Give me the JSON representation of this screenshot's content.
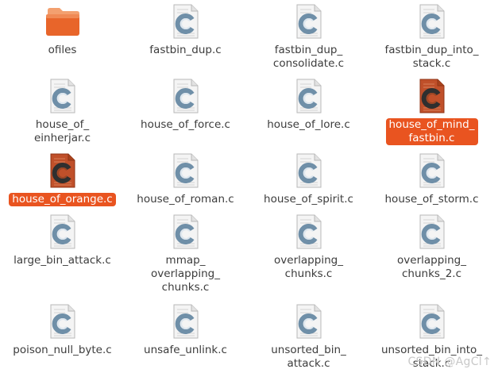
{
  "files": [
    {
      "name": "ofiles",
      "kind": "folder",
      "selected": false
    },
    {
      "name": "fastbin_dup.c",
      "kind": "c-source",
      "selected": false
    },
    {
      "name": "fastbin_dup_\nconsolidate.c",
      "kind": "c-source",
      "selected": false
    },
    {
      "name": "fastbin_dup_into_\nstack.c",
      "kind": "c-source",
      "selected": false
    },
    {
      "name": "house_of_\neinherjar.c",
      "kind": "c-source",
      "selected": false
    },
    {
      "name": "house_of_force.c",
      "kind": "c-source",
      "selected": false
    },
    {
      "name": "house_of_lore.c",
      "kind": "c-source",
      "selected": false
    },
    {
      "name": "house_of_mind_\nfastbin.c",
      "kind": "c-source",
      "selected": true
    },
    {
      "name": "house_of_orange.c",
      "kind": "c-source",
      "selected": true
    },
    {
      "name": "house_of_roman.c",
      "kind": "c-source",
      "selected": false
    },
    {
      "name": "house_of_spirit.c",
      "kind": "c-source",
      "selected": false
    },
    {
      "name": "house_of_storm.c",
      "kind": "c-source",
      "selected": false
    },
    {
      "name": "large_bin_attack.c",
      "kind": "c-source",
      "selected": false
    },
    {
      "name": "mmap_\noverlapping_\nchunks.c",
      "kind": "c-source",
      "selected": false
    },
    {
      "name": "overlapping_\nchunks.c",
      "kind": "c-source",
      "selected": false
    },
    {
      "name": "overlapping_\nchunks_2.c",
      "kind": "c-source",
      "selected": false
    },
    {
      "name": "poison_null_byte.c",
      "kind": "c-source",
      "selected": false
    },
    {
      "name": "unsafe_unlink.c",
      "kind": "c-source",
      "selected": false
    },
    {
      "name": "unsorted_bin_\nattack.c",
      "kind": "c-source",
      "selected": false
    },
    {
      "name": "unsorted_bin_into_\nstack.c",
      "kind": "c-source",
      "selected": false
    }
  ],
  "watermark": "CSDN @AgCl↑",
  "colors": {
    "selection": "#e95420",
    "folder_top": "#f08a55",
    "folder_body": "#e8652a",
    "icon_ring": "#6f8fa8"
  }
}
